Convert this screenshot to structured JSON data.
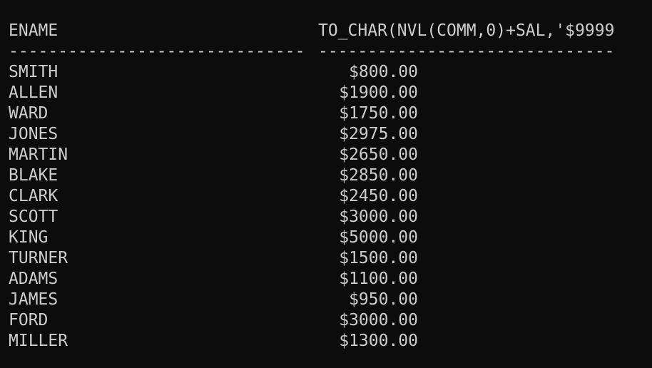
{
  "columns": {
    "ename_header": "ENAME",
    "value_header": "TO_CHAR(NVL(COMM,0)+SAL,'$9999",
    "ename_separator": "------------------------------",
    "value_separator": "------------------------------"
  },
  "rows": [
    {
      "ename": "SMITH",
      "value": "$800.00"
    },
    {
      "ename": "ALLEN",
      "value": "$1900.00"
    },
    {
      "ename": "WARD",
      "value": "$1750.00"
    },
    {
      "ename": "JONES",
      "value": "$2975.00"
    },
    {
      "ename": "MARTIN",
      "value": "$2650.00"
    },
    {
      "ename": "BLAKE",
      "value": "$2850.00"
    },
    {
      "ename": "CLARK",
      "value": "$2450.00"
    },
    {
      "ename": "SCOTT",
      "value": "$3000.00"
    },
    {
      "ename": "KING",
      "value": "$5000.00"
    },
    {
      "ename": "TURNER",
      "value": "$1500.00"
    },
    {
      "ename": "ADAMS",
      "value": "$1100.00"
    },
    {
      "ename": "JAMES",
      "value": "$950.00"
    },
    {
      "ename": "FORD",
      "value": "$3000.00"
    },
    {
      "ename": "MILLER",
      "value": "$1300.00"
    }
  ],
  "colors": {
    "background": "#0c0c0c",
    "text": "#cccccc"
  }
}
